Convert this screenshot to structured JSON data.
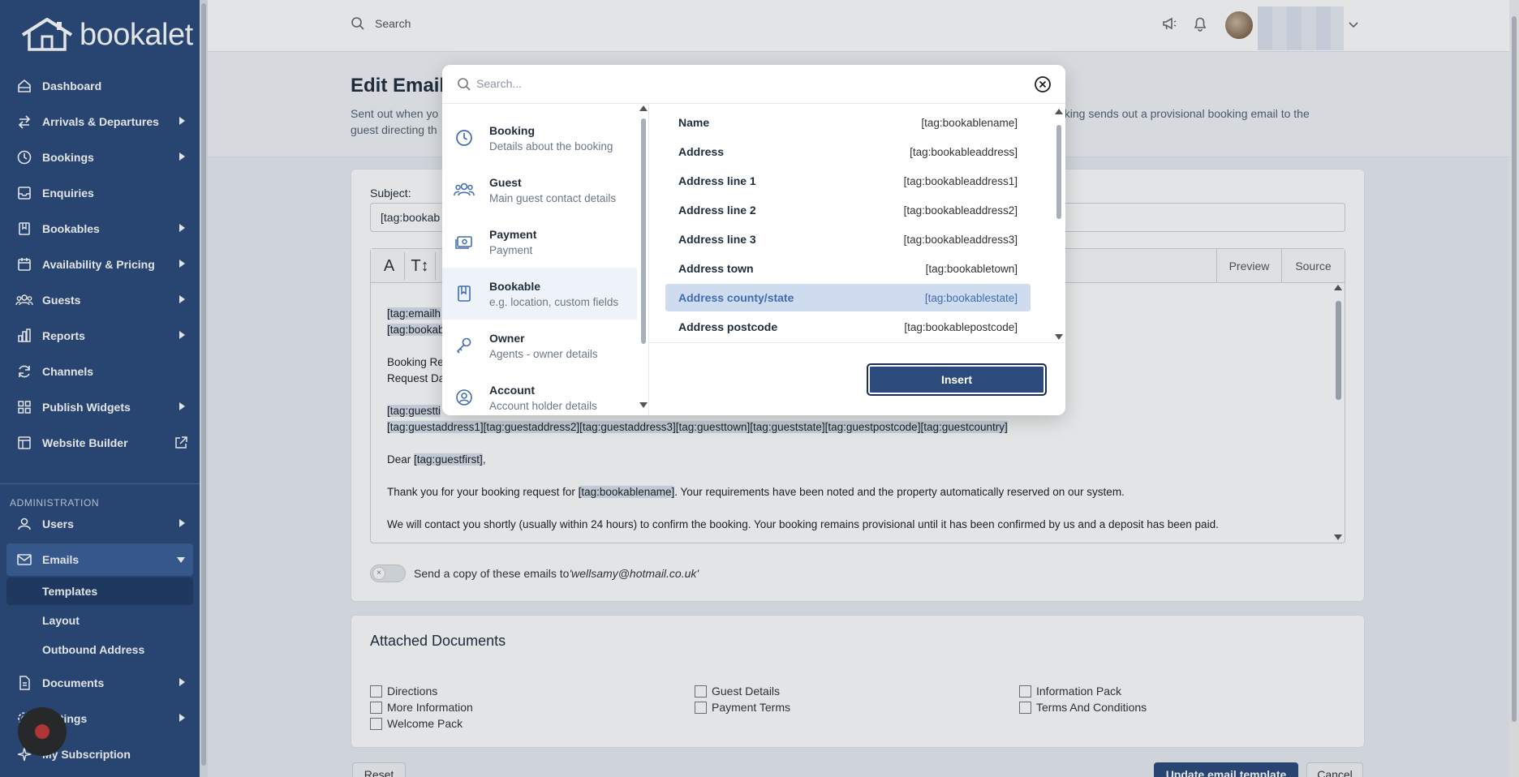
{
  "app": {
    "logo_text": "bookalet"
  },
  "colors": {
    "sidebar": "#2c4a7c",
    "accent": "#3f6cb0",
    "selected_row": "#cfdcf0"
  },
  "topbar": {
    "search_placeholder": "Search"
  },
  "sidebar": {
    "items": [
      {
        "label": "Dashboard",
        "icon": "home-icon"
      },
      {
        "label": "Arrivals & Departures",
        "icon": "arrows-icon"
      },
      {
        "label": "Bookings",
        "icon": "clock-icon"
      },
      {
        "label": "Enquiries",
        "icon": "inbox-icon"
      },
      {
        "label": "Bookables",
        "icon": "book-icon"
      },
      {
        "label": "Availability & Pricing",
        "icon": "calendar-icon"
      },
      {
        "label": "Guests",
        "icon": "users-icon"
      },
      {
        "label": "Reports",
        "icon": "chart-icon"
      },
      {
        "label": "Channels",
        "icon": "sync-icon"
      },
      {
        "label": "Publish Widgets",
        "icon": "grid-icon"
      },
      {
        "label": "Website Builder",
        "icon": "layout-icon"
      }
    ],
    "admin_label": "ADMINISTRATION",
    "admin_items": [
      {
        "label": "Users"
      },
      {
        "label": "Emails"
      }
    ],
    "email_sub": [
      "Templates",
      "Layout",
      "Outbound Address"
    ],
    "lower_items": [
      {
        "label": "Documents"
      },
      {
        "label": "Settings"
      },
      {
        "label": "My Subscription"
      }
    ]
  },
  "page": {
    "title": "Edit Email",
    "desc_left": "Sent out when yo",
    "desc_right": "oking sends out a provisional booking email to the",
    "desc_line2": "guest directing th"
  },
  "form": {
    "subject_label": "Subject:",
    "subject_value": "[tag:bookab",
    "toolbar": {
      "font": "A",
      "size": "T↕",
      "preview": "Preview",
      "source": "Source"
    },
    "editor_lines": {
      "l1": "[tag:emailh",
      "l2": "[tag:bookab",
      "l3": "Booking Re",
      "l4": "Request Da",
      "l5": "[tag:guestti",
      "l6": "[tag:guestaddress1][tag:guestaddress2][tag:guestaddress3][tag:guesttown][tag:gueststate][tag:guestpostcode][tag:guestcountry]",
      "dear_prefix": "Dear ",
      "dear_tag": "[tag:guestfirst]",
      "dear_suffix": ",",
      "thanks_prefix": "Thank you for your booking request for ",
      "thanks_tag": "[tag:bookablename]",
      "thanks_suffix": ". Your requirements have been noted and the property automatically reserved on our system.",
      "contact": "We will contact you shortly (usually within 24 hours) to confirm the booking. Your booking remains provisional until it has been confirmed by us and a deposit has been paid."
    },
    "copy_text": "Send a copy of these emails to",
    "copy_email": "'wellsamy@hotmail.co.uk'"
  },
  "documents": {
    "title": "Attached Documents",
    "items": [
      "Directions",
      "More Information",
      "Welcome Pack",
      "Guest Details",
      "Payment Terms",
      "Information Pack",
      "Terms And Conditions"
    ]
  },
  "bottom": {
    "reset": "Reset",
    "update": "Update email template",
    "cancel": "Cancel"
  },
  "modal": {
    "search_placeholder": "Search...",
    "categories": [
      {
        "name": "Booking",
        "sub": "Details about the booking",
        "icon": "clock-icon"
      },
      {
        "name": "Guest",
        "sub": "Main guest contact details",
        "icon": "users-icon"
      },
      {
        "name": "Payment",
        "sub": "Payment",
        "icon": "payment-icon"
      },
      {
        "name": "Bookable",
        "sub": "e.g. location, custom fields",
        "icon": "book-icon"
      },
      {
        "name": "Owner",
        "sub": "Agents - owner details",
        "icon": "key-icon"
      },
      {
        "name": "Account",
        "sub": "Account holder details",
        "icon": "account-icon"
      }
    ],
    "active_category": "Bookable",
    "tags": [
      {
        "label": "Name",
        "code": "[tag:bookablename]"
      },
      {
        "label": "Address",
        "code": "[tag:bookableaddress]"
      },
      {
        "label": "Address line 1",
        "code": "[tag:bookableaddress1]"
      },
      {
        "label": "Address line 2",
        "code": "[tag:bookableaddress2]"
      },
      {
        "label": "Address line 3",
        "code": "[tag:bookableaddress3]"
      },
      {
        "label": "Address town",
        "code": "[tag:bookabletown]"
      },
      {
        "label": "Address county/state",
        "code": "[tag:bookablestate]"
      },
      {
        "label": "Address postcode",
        "code": "[tag:bookablepostcode]"
      }
    ],
    "selected_tag": "Address county/state",
    "insert_label": "Insert"
  }
}
